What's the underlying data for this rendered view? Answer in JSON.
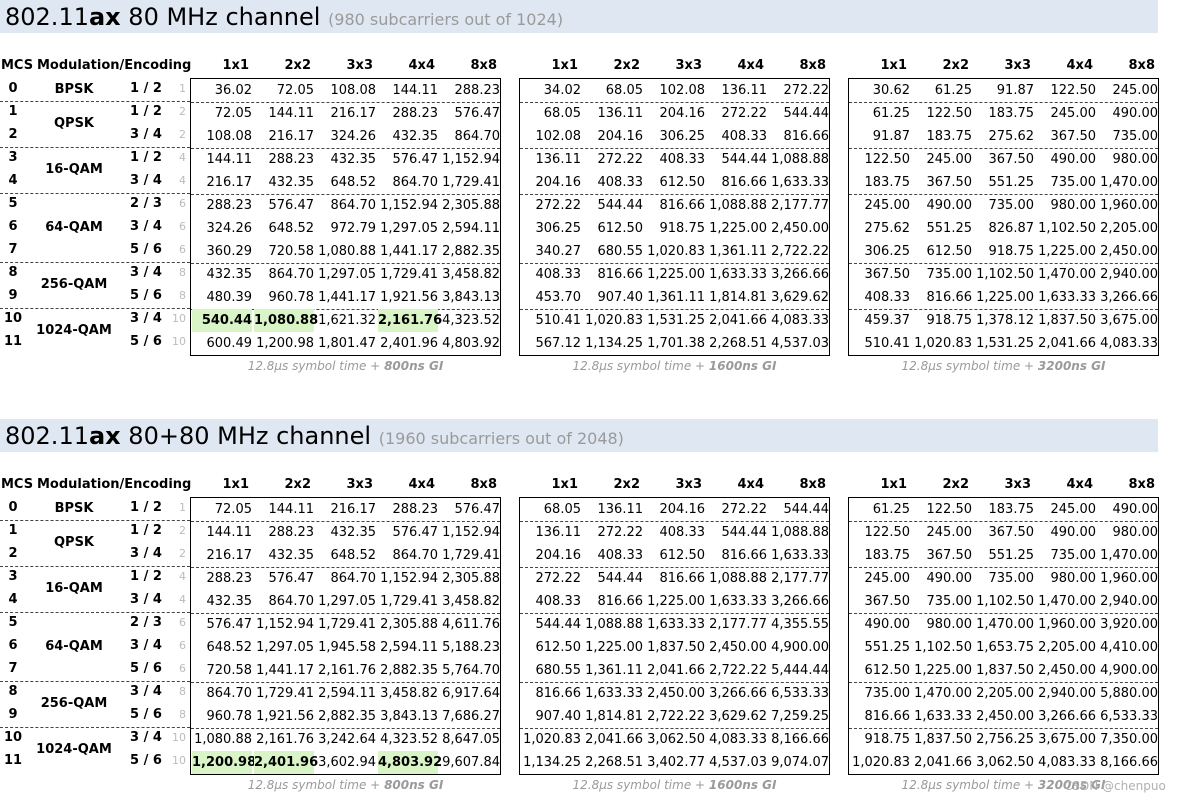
{
  "sections": [
    {
      "title_prefix": "802.11",
      "title_bold": "ax",
      "title_rest": " 80 MHz channel",
      "title_sub": "(980 subcarriers out of 1024)",
      "highlights": {
        "g0": [
          [
            10,
            0
          ],
          [
            10,
            1
          ],
          [
            10,
            3
          ]
        ]
      },
      "guard_tables": [
        {
          "caption_prefix": "12.8µs symbol time + ",
          "caption_bold": "800ns GI",
          "rows": [
            [
              "36.02",
              "72.05",
              "108.08",
              "144.11",
              "288.23"
            ],
            [
              "72.05",
              "144.11",
              "216.17",
              "288.23",
              "576.47"
            ],
            [
              "108.08",
              "216.17",
              "324.26",
              "432.35",
              "864.70"
            ],
            [
              "144.11",
              "288.23",
              "432.35",
              "576.47",
              "1,152.94"
            ],
            [
              "216.17",
              "432.35",
              "648.52",
              "864.70",
              "1,729.41"
            ],
            [
              "288.23",
              "576.47",
              "864.70",
              "1,152.94",
              "2,305.88"
            ],
            [
              "324.26",
              "648.52",
              "972.79",
              "1,297.05",
              "2,594.11"
            ],
            [
              "360.29",
              "720.58",
              "1,080.88",
              "1,441.17",
              "2,882.35"
            ],
            [
              "432.35",
              "864.70",
              "1,297.05",
              "1,729.41",
              "3,458.82"
            ],
            [
              "480.39",
              "960.78",
              "1,441.17",
              "1,921.56",
              "3,843.13"
            ],
            [
              "540.44",
              "1,080.88",
              "1,621.32",
              "2,161.76",
              "4,323.52"
            ],
            [
              "600.49",
              "1,200.98",
              "1,801.47",
              "2,401.96",
              "4,803.92"
            ]
          ]
        },
        {
          "caption_prefix": "12.8µs symbol time + ",
          "caption_bold": "1600ns GI",
          "rows": [
            [
              "34.02",
              "68.05",
              "102.08",
              "136.11",
              "272.22"
            ],
            [
              "68.05",
              "136.11",
              "204.16",
              "272.22",
              "544.44"
            ],
            [
              "102.08",
              "204.16",
              "306.25",
              "408.33",
              "816.66"
            ],
            [
              "136.11",
              "272.22",
              "408.33",
              "544.44",
              "1,088.88"
            ],
            [
              "204.16",
              "408.33",
              "612.50",
              "816.66",
              "1,633.33"
            ],
            [
              "272.22",
              "544.44",
              "816.66",
              "1,088.88",
              "2,177.77"
            ],
            [
              "306.25",
              "612.50",
              "918.75",
              "1,225.00",
              "2,450.00"
            ],
            [
              "340.27",
              "680.55",
              "1,020.83",
              "1,361.11",
              "2,722.22"
            ],
            [
              "408.33",
              "816.66",
              "1,225.00",
              "1,633.33",
              "3,266.66"
            ],
            [
              "453.70",
              "907.40",
              "1,361.11",
              "1,814.81",
              "3,629.62"
            ],
            [
              "510.41",
              "1,020.83",
              "1,531.25",
              "2,041.66",
              "4,083.33"
            ],
            [
              "567.12",
              "1,134.25",
              "1,701.38",
              "2,268.51",
              "4,537.03"
            ]
          ]
        },
        {
          "caption_prefix": "12.8µs symbol time + ",
          "caption_bold": "3200ns GI",
          "rows": [
            [
              "30.62",
              "61.25",
              "91.87",
              "122.50",
              "245.00"
            ],
            [
              "61.25",
              "122.50",
              "183.75",
              "245.00",
              "490.00"
            ],
            [
              "91.87",
              "183.75",
              "275.62",
              "367.50",
              "735.00"
            ],
            [
              "122.50",
              "245.00",
              "367.50",
              "490.00",
              "980.00"
            ],
            [
              "183.75",
              "367.50",
              "551.25",
              "735.00",
              "1,470.00"
            ],
            [
              "245.00",
              "490.00",
              "735.00",
              "980.00",
              "1,960.00"
            ],
            [
              "275.62",
              "551.25",
              "826.87",
              "1,102.50",
              "2,205.00"
            ],
            [
              "306.25",
              "612.50",
              "918.75",
              "1,225.00",
              "2,450.00"
            ],
            [
              "367.50",
              "735.00",
              "1,102.50",
              "1,470.00",
              "2,940.00"
            ],
            [
              "408.33",
              "816.66",
              "1,225.00",
              "1,633.33",
              "3,266.66"
            ],
            [
              "459.37",
              "918.75",
              "1,378.12",
              "1,837.50",
              "3,675.00"
            ],
            [
              "510.41",
              "1,020.83",
              "1,531.25",
              "2,041.66",
              "4,083.33"
            ]
          ]
        }
      ]
    },
    {
      "title_prefix": "802.11",
      "title_bold": "ax",
      "title_rest": " 80+80 MHz channel",
      "title_sub": "(1960 subcarriers out of 2048)",
      "highlights": {
        "g0": [
          [
            11,
            0
          ],
          [
            11,
            1
          ],
          [
            11,
            3
          ]
        ]
      },
      "guard_tables": [
        {
          "caption_prefix": "12.8µs symbol time + ",
          "caption_bold": "800ns GI",
          "rows": [
            [
              "72.05",
              "144.11",
              "216.17",
              "288.23",
              "576.47"
            ],
            [
              "144.11",
              "288.23",
              "432.35",
              "576.47",
              "1,152.94"
            ],
            [
              "216.17",
              "432.35",
              "648.52",
              "864.70",
              "1,729.41"
            ],
            [
              "288.23",
              "576.47",
              "864.70",
              "1,152.94",
              "2,305.88"
            ],
            [
              "432.35",
              "864.70",
              "1,297.05",
              "1,729.41",
              "3,458.82"
            ],
            [
              "576.47",
              "1,152.94",
              "1,729.41",
              "2,305.88",
              "4,611.76"
            ],
            [
              "648.52",
              "1,297.05",
              "1,945.58",
              "2,594.11",
              "5,188.23"
            ],
            [
              "720.58",
              "1,441.17",
              "2,161.76",
              "2,882.35",
              "5,764.70"
            ],
            [
              "864.70",
              "1,729.41",
              "2,594.11",
              "3,458.82",
              "6,917.64"
            ],
            [
              "960.78",
              "1,921.56",
              "2,882.35",
              "3,843.13",
              "7,686.27"
            ],
            [
              "1,080.88",
              "2,161.76",
              "3,242.64",
              "4,323.52",
              "8,647.05"
            ],
            [
              "1,200.98",
              "2,401.96",
              "3,602.94",
              "4,803.92",
              "9,607.84"
            ]
          ]
        },
        {
          "caption_prefix": "12.8µs symbol time + ",
          "caption_bold": "1600ns GI",
          "rows": [
            [
              "68.05",
              "136.11",
              "204.16",
              "272.22",
              "544.44"
            ],
            [
              "136.11",
              "272.22",
              "408.33",
              "544.44",
              "1,088.88"
            ],
            [
              "204.16",
              "408.33",
              "612.50",
              "816.66",
              "1,633.33"
            ],
            [
              "272.22",
              "544.44",
              "816.66",
              "1,088.88",
              "2,177.77"
            ],
            [
              "408.33",
              "816.66",
              "1,225.00",
              "1,633.33",
              "3,266.66"
            ],
            [
              "544.44",
              "1,088.88",
              "1,633.33",
              "2,177.77",
              "4,355.55"
            ],
            [
              "612.50",
              "1,225.00",
              "1,837.50",
              "2,450.00",
              "4,900.00"
            ],
            [
              "680.55",
              "1,361.11",
              "2,041.66",
              "2,722.22",
              "5,444.44"
            ],
            [
              "816.66",
              "1,633.33",
              "2,450.00",
              "3,266.66",
              "6,533.33"
            ],
            [
              "907.40",
              "1,814.81",
              "2,722.22",
              "3,629.62",
              "7,259.25"
            ],
            [
              "1,020.83",
              "2,041.66",
              "3,062.50",
              "4,083.33",
              "8,166.66"
            ],
            [
              "1,134.25",
              "2,268.51",
              "3,402.77",
              "4,537.03",
              "9,074.07"
            ]
          ]
        },
        {
          "caption_prefix": "12.8µs symbol time + ",
          "caption_bold": "3200ns GI",
          "rows": [
            [
              "61.25",
              "122.50",
              "183.75",
              "245.00",
              "490.00"
            ],
            [
              "122.50",
              "245.00",
              "367.50",
              "490.00",
              "980.00"
            ],
            [
              "183.75",
              "367.50",
              "551.25",
              "735.00",
              "1,470.00"
            ],
            [
              "245.00",
              "490.00",
              "735.00",
              "980.00",
              "1,960.00"
            ],
            [
              "367.50",
              "735.00",
              "1,102.50",
              "1,470.00",
              "2,940.00"
            ],
            [
              "490.00",
              "980.00",
              "1,470.00",
              "1,960.00",
              "3,920.00"
            ],
            [
              "551.25",
              "1,102.50",
              "1,653.75",
              "2,205.00",
              "4,410.00"
            ],
            [
              "612.50",
              "1,225.00",
              "1,837.50",
              "2,450.00",
              "4,900.00"
            ],
            [
              "735.00",
              "1,470.00",
              "2,205.00",
              "2,940.00",
              "5,880.00"
            ],
            [
              "816.66",
              "1,633.33",
              "2,450.00",
              "3,266.66",
              "6,533.33"
            ],
            [
              "918.75",
              "1,837.50",
              "2,756.25",
              "3,675.00",
              "7,350.00"
            ],
            [
              "1,020.83",
              "2,041.66",
              "3,062.50",
              "4,083.33",
              "8,166.66"
            ]
          ]
        }
      ]
    }
  ],
  "headers": {
    "mcs": "MCS",
    "modulation": "Modulation/Encoding",
    "streams": [
      "1x1",
      "2x2",
      "3x3",
      "4x4",
      "8x8"
    ]
  },
  "mcs_rows": [
    {
      "mcs": "0",
      "code": "1 / 2",
      "nss": "1"
    },
    {
      "mcs": "1",
      "code": "1 / 2",
      "nss": "2"
    },
    {
      "mcs": "2",
      "code": "3 / 4",
      "nss": "2"
    },
    {
      "mcs": "3",
      "code": "1 / 2",
      "nss": "4"
    },
    {
      "mcs": "4",
      "code": "3 / 4",
      "nss": "4"
    },
    {
      "mcs": "5",
      "code": "2 / 3",
      "nss": "6"
    },
    {
      "mcs": "6",
      "code": "3 / 4",
      "nss": "6"
    },
    {
      "mcs": "7",
      "code": "5 / 6",
      "nss": "6"
    },
    {
      "mcs": "8",
      "code": "3 / 4",
      "nss": "8"
    },
    {
      "mcs": "9",
      "code": "5 / 6",
      "nss": "8"
    },
    {
      "mcs": "10",
      "code": "3 / 4",
      "nss": "10"
    },
    {
      "mcs": "11",
      "code": "5 / 6",
      "nss": "10"
    }
  ],
  "modulations": [
    "BPSK",
    "QPSK",
    "16-QAM",
    "64-QAM",
    "256-QAM",
    "1024-QAM"
  ],
  "highlight_color": "#d9f5c7",
  "watermark": "CSDN @chenpuo"
}
